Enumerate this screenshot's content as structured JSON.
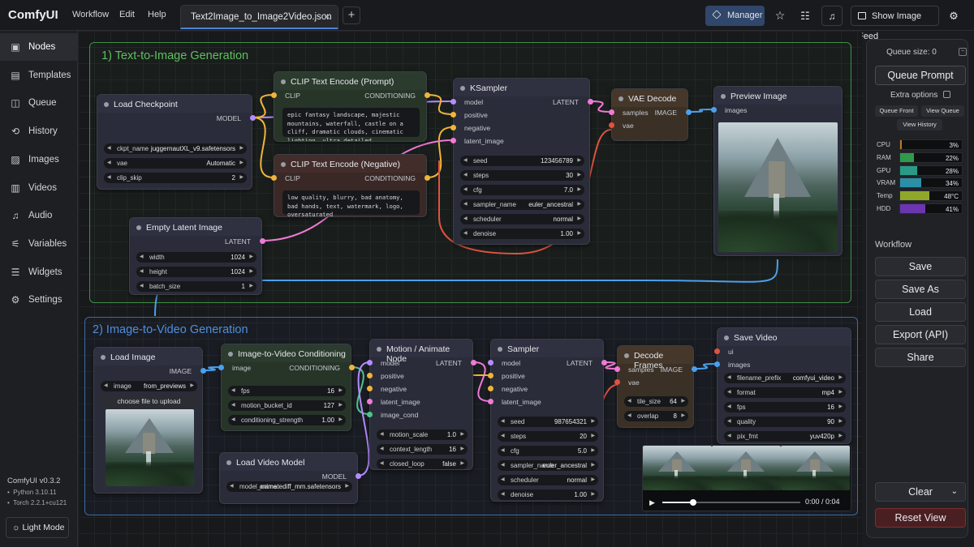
{
  "app": {
    "title": "ComfyUI",
    "menu": [
      "Workflow",
      "Edit",
      "Help"
    ],
    "tab": "Text2Image_to_Image2Video.json",
    "tab_close": "✕",
    "tab_add": "+",
    "manager": "Manager",
    "show_feed": "Show Image Feed"
  },
  "sidebar": {
    "items": [
      {
        "label": "Nodes",
        "icon": "nodes-icon",
        "glyph": "▣"
      },
      {
        "label": "Templates",
        "icon": "templates-icon",
        "glyph": "▤"
      },
      {
        "label": "Queue",
        "icon": "queue-icon",
        "glyph": "◫"
      },
      {
        "label": "History",
        "icon": "history-icon",
        "glyph": "⟲"
      },
      {
        "label": "Images",
        "icon": "images-icon",
        "glyph": "▨"
      },
      {
        "label": "Videos",
        "icon": "videos-icon",
        "glyph": "▥"
      },
      {
        "label": "Audio",
        "icon": "audio-icon",
        "glyph": "♫"
      },
      {
        "label": "Variables",
        "icon": "variables-icon",
        "glyph": "⚟"
      },
      {
        "label": "Widgets",
        "icon": "widgets-icon",
        "glyph": "☰"
      },
      {
        "label": "Settings",
        "icon": "settings-icon",
        "glyph": "⚙"
      }
    ],
    "version": "ComfyUI v0.3.2",
    "python": "Python 3.10.11",
    "torch": "Torch 2.2.1+cu121",
    "light_mode": "Light Mode"
  },
  "groups": {
    "g1": "1) Text-to-Image Generation",
    "g2": "2) Image-to-Video Generation"
  },
  "nodes": {
    "load_checkpoint": {
      "title": "Load Checkpoint",
      "out": "MODEL",
      "w": [
        [
          "ckpt_name",
          "juggernautXL_v9.safetensors"
        ],
        [
          "vae",
          "Automatic"
        ],
        [
          "clip_skip",
          "2"
        ]
      ]
    },
    "clip_pos": {
      "title": "CLIP Text Encode (Prompt)",
      "in": "CLIP",
      "out": "CONDITIONING",
      "text": "epic fantasy landscape, majestic mountains, waterfall, castle on a cliff, dramatic clouds, cinematic lighting, ultra detailed"
    },
    "clip_neg": {
      "title": "CLIP Text Encode (Negative)",
      "in": "CLIP",
      "out": "CONDITIONING",
      "text": "low quality, blurry, bad anatomy, bad hands, text, watermark, logo, oversaturated"
    },
    "empty_latent": {
      "title": "Empty Latent Image",
      "out": "LATENT",
      "w": [
        [
          "width",
          "1024"
        ],
        [
          "height",
          "1024"
        ],
        [
          "batch_size",
          "1"
        ]
      ]
    },
    "ksampler": {
      "title": "KSampler",
      "ins": [
        "model",
        "positive",
        "negative",
        "latent_image"
      ],
      "out": "LATENT",
      "w": [
        [
          "seed",
          "123456789"
        ],
        [
          "steps",
          "30"
        ],
        [
          "cfg",
          "7.0"
        ],
        [
          "sampler_name",
          "euler_ancestral"
        ],
        [
          "scheduler",
          "normal"
        ],
        [
          "denoise",
          "1.00"
        ]
      ]
    },
    "vae_decode": {
      "title": "VAE Decode",
      "ins": [
        "samples",
        "vae"
      ],
      "out": "IMAGE"
    },
    "preview": {
      "title": "Preview Image",
      "in": "images"
    },
    "load_image": {
      "title": "Load Image",
      "out": "IMAGE",
      "w": [
        [
          "image",
          "from_previews"
        ]
      ],
      "btn": "choose file to upload"
    },
    "i2v_cond": {
      "title": "Image-to-Video Conditioning",
      "in": "image",
      "out": "CONDITIONING",
      "w": [
        [
          "fps",
          "16"
        ],
        [
          "motion_bucket_id",
          "127"
        ],
        [
          "conditioning_strength",
          "1.00"
        ]
      ]
    },
    "motion": {
      "title": "Motion / Animate Node",
      "ins": [
        "model",
        "positive",
        "negative",
        "latent_image",
        "image_cond"
      ],
      "out": "LATENT",
      "w": [
        [
          "motion_scale",
          "1.0"
        ],
        [
          "context_length",
          "16"
        ],
        [
          "closed_loop",
          "false"
        ]
      ]
    },
    "sampler": {
      "title": "Sampler",
      "ins": [
        "model",
        "positive",
        "negative",
        "latent_image"
      ],
      "out": "LATENT",
      "w": [
        [
          "seed",
          "987654321"
        ],
        [
          "steps",
          "20"
        ],
        [
          "cfg",
          "5.0"
        ],
        [
          "sampler_name",
          "euler_ancestral"
        ],
        [
          "scheduler",
          "normal"
        ],
        [
          "denoise",
          "1.00"
        ]
      ]
    },
    "decode_frames": {
      "title": "Decode Frames",
      "ins": [
        "samples",
        "vae"
      ],
      "out": "IMAGE",
      "w": [
        [
          "tile_size",
          "64"
        ],
        [
          "overlap",
          "8"
        ]
      ]
    },
    "save_video": {
      "title": "Save Video",
      "ins": [
        "ui",
        "images"
      ],
      "w": [
        [
          "filename_prefix",
          "comfyui_video"
        ],
        [
          "format",
          "mp4"
        ],
        [
          "fps",
          "16"
        ],
        [
          "quality",
          "90"
        ],
        [
          "pix_fmt",
          "yuv420p"
        ]
      ]
    },
    "load_video_model": {
      "title": "Load Video Model",
      "out": "MODEL",
      "w": [
        [
          "model_name",
          "animatediff_mm.safetensors"
        ]
      ]
    }
  },
  "video": {
    "time": "0:00 / 0:04",
    "progress": 0.22
  },
  "panel": {
    "queue_size": "Queue size: 0",
    "queue_prompt": "Queue Prompt",
    "extra_options": "Extra options",
    "queue_front": "Queue Front",
    "view_queue": "View Queue",
    "view_history": "View History",
    "stats": [
      {
        "label": "CPU",
        "value": "3%",
        "fraction": 0.03,
        "color": "#b87a2e"
      },
      {
        "label": "RAM",
        "value": "22%",
        "fraction": 0.22,
        "color": "#2f9a4c"
      },
      {
        "label": "GPU",
        "value": "28%",
        "fraction": 0.28,
        "color": "#2a9a86"
      },
      {
        "label": "VRAM",
        "value": "34%",
        "fraction": 0.34,
        "color": "#2c8fa8"
      },
      {
        "label": "Temp",
        "value": "48°C",
        "fraction": 0.48,
        "color": "#8fa82a"
      },
      {
        "label": "HDD",
        "value": "41%",
        "fraction": 0.41,
        "color": "#6b36b0"
      }
    ],
    "workflow": "Workflow",
    "save": "Save",
    "save_as": "Save As",
    "load": "Load",
    "export_api": "Export (API)",
    "share": "Share",
    "clear": "Clear",
    "reset_view": "Reset View"
  },
  "colors": {
    "accent": "#4c83d6",
    "group1": "#3f8f46",
    "group2": "#3e6aa5",
    "link_model": "#b58cff",
    "link_cond": "#f0b43a",
    "link_latent": "#f07ad6",
    "link_image": "#4aa0ee",
    "link_vae": "#e0533f"
  }
}
